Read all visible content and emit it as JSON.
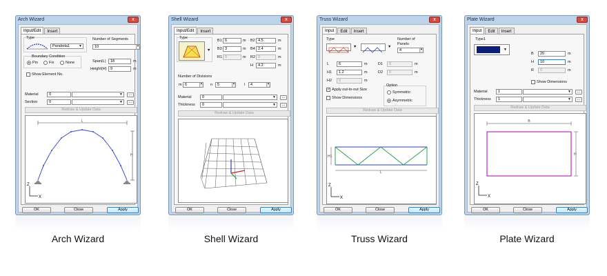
{
  "arch": {
    "title": "Arch Wizard",
    "tabs": [
      "Input/Edit",
      "Insert"
    ],
    "type_label": "Type",
    "type_value": "Parabola1",
    "segments_label": "Number of Segments",
    "segments_value": "10",
    "boundary_label": "Boundary Condition",
    "boundary_options": [
      "Pin",
      "Fix",
      "None"
    ],
    "span_label": "Span(L)",
    "span_value": "18",
    "height_label": "Height(H)",
    "height_value": "9",
    "unit": "m",
    "show_element_label": "Show Element No.",
    "material_label": "Material",
    "material_value": "0",
    "section_label": "Section",
    "section_value": "0",
    "redraw_label": "Redraw & Update Data",
    "dim_l": "L",
    "dim_h": "H",
    "ok_label": "OK",
    "close_label": "Close",
    "apply_label": "Apply",
    "caption": "Arch Wizard"
  },
  "shell": {
    "title": "Shell Wizard",
    "tabs": [
      "Input/Edit",
      "Insert"
    ],
    "type_label": "Type",
    "b1_label": "B1",
    "b1_value": "6",
    "b2_label": "B2",
    "b2_value": "4.5",
    "b3_label": "B3",
    "b3_value": "3",
    "b4_label": "B4",
    "b4_value": "2.4",
    "r1_label": "R1",
    "r1_value": "0",
    "r2_label": "R2",
    "r2_value": "0",
    "h_label": "H",
    "h_value": "4.2",
    "unit": "m",
    "divisions_label": "Number of Divisions",
    "m_label": "m",
    "m_value": "6",
    "n_label": "n",
    "n_value": "5",
    "l_label": "l",
    "l_value": "4",
    "material_label": "Material",
    "material_value": "0",
    "thickness_label": "Thickness",
    "thickness_value": "0",
    "redraw_label": "Redraw & Update Data",
    "ok_label": "OK",
    "close_label": "Close",
    "apply_label": "Apply",
    "caption": "Shell Wizard"
  },
  "truss": {
    "title": "Truss Wizard",
    "tabs": [
      "Input",
      "Edit",
      "Insert"
    ],
    "type_label": "Type",
    "panels_label": "Number of Panels",
    "panels_value": "4",
    "l_label": "L",
    "l_value": "6",
    "h1_label": "H1",
    "h1_value": "1.2",
    "h2_label": "H2",
    "h2_value": "0",
    "d1_label": "D1",
    "d1_value": "0",
    "d2_label": "D2",
    "d2_value": "0",
    "unit": "m",
    "apply_out_label": "Apply out-to-out Size",
    "show_dim_label": "Show Dimensions",
    "option_label": "Option",
    "option_values": [
      "Symmetric",
      "Asymmetric"
    ],
    "redraw_label": "Redraw & Update Data",
    "dim_l": "L",
    "dim_h1": "H1",
    "ok_label": "OK",
    "close_label": "Close",
    "apply_label": "Apply",
    "caption": "Truss Wizard"
  },
  "plate": {
    "title": "Plate Wizard",
    "tabs": [
      "Input",
      "Edit",
      "Insert"
    ],
    "type_label": "Type1",
    "b_label": "B",
    "b_value": "20",
    "h_label": "H",
    "h_value": "10",
    "r_label": "R",
    "r_value": "0",
    "unit": "m",
    "show_dim_label": "Show Dimensions",
    "material_label": "Material",
    "material_value": "1",
    "thickness_label": "Thickness",
    "thickness_value": "1",
    "redraw_label": "Redraw & Update Data",
    "dim_b": "B",
    "dim_h": "H",
    "ok_label": "OK",
    "close_label": "Close",
    "apply_label": "Apply",
    "caption": "Plate Wizard"
  },
  "axis": {
    "z": "Z",
    "x": "X"
  },
  "close_glyph": "x",
  "more_glyph": "...",
  "dropdown_arrow": "▼",
  "colors": {
    "titlebar": "#bcd3ea",
    "close": "#d44c3c",
    "plate_fill": "#0b1f7a",
    "plate_rect": "#b000b0",
    "truss_chord": "#2a3fc0",
    "truss_web": "#2aa04a",
    "arch_curve": "#3c4fd0"
  }
}
